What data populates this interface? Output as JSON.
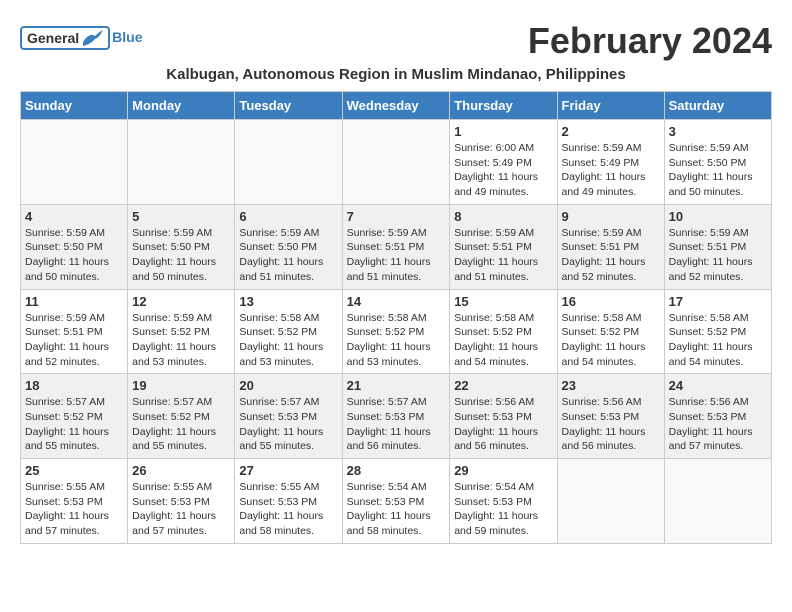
{
  "logo": {
    "general": "General",
    "blue": "Blue"
  },
  "title": "February 2024",
  "subtitle": "Kalbugan, Autonomous Region in Muslim Mindanao, Philippines",
  "days_of_week": [
    "Sunday",
    "Monday",
    "Tuesday",
    "Wednesday",
    "Thursday",
    "Friday",
    "Saturday"
  ],
  "weeks": [
    [
      {
        "day": "",
        "info": ""
      },
      {
        "day": "",
        "info": ""
      },
      {
        "day": "",
        "info": ""
      },
      {
        "day": "",
        "info": ""
      },
      {
        "day": "1",
        "info": "Sunrise: 6:00 AM\nSunset: 5:49 PM\nDaylight: 11 hours\nand 49 minutes."
      },
      {
        "day": "2",
        "info": "Sunrise: 5:59 AM\nSunset: 5:49 PM\nDaylight: 11 hours\nand 49 minutes."
      },
      {
        "day": "3",
        "info": "Sunrise: 5:59 AM\nSunset: 5:50 PM\nDaylight: 11 hours\nand 50 minutes."
      }
    ],
    [
      {
        "day": "4",
        "info": "Sunrise: 5:59 AM\nSunset: 5:50 PM\nDaylight: 11 hours\nand 50 minutes."
      },
      {
        "day": "5",
        "info": "Sunrise: 5:59 AM\nSunset: 5:50 PM\nDaylight: 11 hours\nand 50 minutes."
      },
      {
        "day": "6",
        "info": "Sunrise: 5:59 AM\nSunset: 5:50 PM\nDaylight: 11 hours\nand 51 minutes."
      },
      {
        "day": "7",
        "info": "Sunrise: 5:59 AM\nSunset: 5:51 PM\nDaylight: 11 hours\nand 51 minutes."
      },
      {
        "day": "8",
        "info": "Sunrise: 5:59 AM\nSunset: 5:51 PM\nDaylight: 11 hours\nand 51 minutes."
      },
      {
        "day": "9",
        "info": "Sunrise: 5:59 AM\nSunset: 5:51 PM\nDaylight: 11 hours\nand 52 minutes."
      },
      {
        "day": "10",
        "info": "Sunrise: 5:59 AM\nSunset: 5:51 PM\nDaylight: 11 hours\nand 52 minutes."
      }
    ],
    [
      {
        "day": "11",
        "info": "Sunrise: 5:59 AM\nSunset: 5:51 PM\nDaylight: 11 hours\nand 52 minutes."
      },
      {
        "day": "12",
        "info": "Sunrise: 5:59 AM\nSunset: 5:52 PM\nDaylight: 11 hours\nand 53 minutes."
      },
      {
        "day": "13",
        "info": "Sunrise: 5:58 AM\nSunset: 5:52 PM\nDaylight: 11 hours\nand 53 minutes."
      },
      {
        "day": "14",
        "info": "Sunrise: 5:58 AM\nSunset: 5:52 PM\nDaylight: 11 hours\nand 53 minutes."
      },
      {
        "day": "15",
        "info": "Sunrise: 5:58 AM\nSunset: 5:52 PM\nDaylight: 11 hours\nand 54 minutes."
      },
      {
        "day": "16",
        "info": "Sunrise: 5:58 AM\nSunset: 5:52 PM\nDaylight: 11 hours\nand 54 minutes."
      },
      {
        "day": "17",
        "info": "Sunrise: 5:58 AM\nSunset: 5:52 PM\nDaylight: 11 hours\nand 54 minutes."
      }
    ],
    [
      {
        "day": "18",
        "info": "Sunrise: 5:57 AM\nSunset: 5:52 PM\nDaylight: 11 hours\nand 55 minutes."
      },
      {
        "day": "19",
        "info": "Sunrise: 5:57 AM\nSunset: 5:52 PM\nDaylight: 11 hours\nand 55 minutes."
      },
      {
        "day": "20",
        "info": "Sunrise: 5:57 AM\nSunset: 5:53 PM\nDaylight: 11 hours\nand 55 minutes."
      },
      {
        "day": "21",
        "info": "Sunrise: 5:57 AM\nSunset: 5:53 PM\nDaylight: 11 hours\nand 56 minutes."
      },
      {
        "day": "22",
        "info": "Sunrise: 5:56 AM\nSunset: 5:53 PM\nDaylight: 11 hours\nand 56 minutes."
      },
      {
        "day": "23",
        "info": "Sunrise: 5:56 AM\nSunset: 5:53 PM\nDaylight: 11 hours\nand 56 minutes."
      },
      {
        "day": "24",
        "info": "Sunrise: 5:56 AM\nSunset: 5:53 PM\nDaylight: 11 hours\nand 57 minutes."
      }
    ],
    [
      {
        "day": "25",
        "info": "Sunrise: 5:55 AM\nSunset: 5:53 PM\nDaylight: 11 hours\nand 57 minutes."
      },
      {
        "day": "26",
        "info": "Sunrise: 5:55 AM\nSunset: 5:53 PM\nDaylight: 11 hours\nand 57 minutes."
      },
      {
        "day": "27",
        "info": "Sunrise: 5:55 AM\nSunset: 5:53 PM\nDaylight: 11 hours\nand 58 minutes."
      },
      {
        "day": "28",
        "info": "Sunrise: 5:54 AM\nSunset: 5:53 PM\nDaylight: 11 hours\nand 58 minutes."
      },
      {
        "day": "29",
        "info": "Sunrise: 5:54 AM\nSunset: 5:53 PM\nDaylight: 11 hours\nand 59 minutes."
      },
      {
        "day": "",
        "info": ""
      },
      {
        "day": "",
        "info": ""
      }
    ]
  ]
}
